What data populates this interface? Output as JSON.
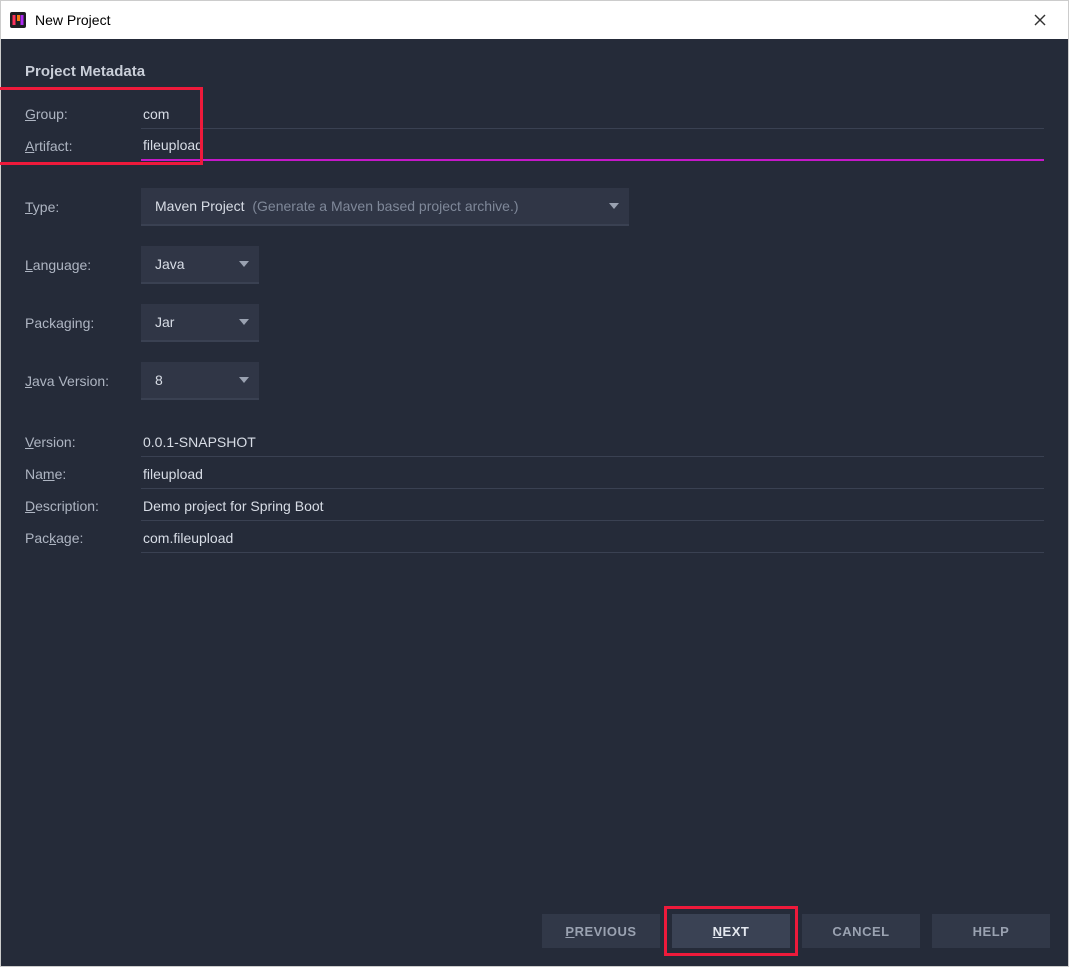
{
  "window": {
    "title": "New Project"
  },
  "section_title": "Project Metadata",
  "fields": {
    "group": {
      "label": "Group:",
      "value": "com",
      "mnemonic": "G"
    },
    "artifact": {
      "label": "Artifact:",
      "value": "fileupload",
      "mnemonic": "A"
    },
    "type": {
      "label": "Type:",
      "value": "Maven Project",
      "hint": "(Generate a Maven based project archive.)",
      "mnemonic": "T"
    },
    "language": {
      "label": "Language:",
      "value": "Java",
      "mnemonic": "L"
    },
    "packaging": {
      "label": "Packaging:",
      "value": "Jar"
    },
    "java_version": {
      "label": "Java Version:",
      "value": "8",
      "mnemonic": "J"
    },
    "version": {
      "label": "Version:",
      "value": "0.0.1-SNAPSHOT",
      "mnemonic": "V"
    },
    "name": {
      "label": "Name:",
      "value": "fileupload",
      "mnemonic": "m"
    },
    "description": {
      "label": "Description:",
      "value": "Demo project for Spring Boot",
      "mnemonic": "D"
    },
    "package": {
      "label": "Package:",
      "value": "com.fileupload",
      "mnemonic": "k"
    }
  },
  "buttons": {
    "previous": {
      "label": "PREVIOUS",
      "mnemonic": "P"
    },
    "next": {
      "label": "NEXT",
      "mnemonic": "N"
    },
    "cancel": {
      "label": "CANCEL"
    },
    "help": {
      "label": "HELP"
    }
  },
  "annotations": {
    "group_artifact_box": true,
    "next_box": true
  }
}
